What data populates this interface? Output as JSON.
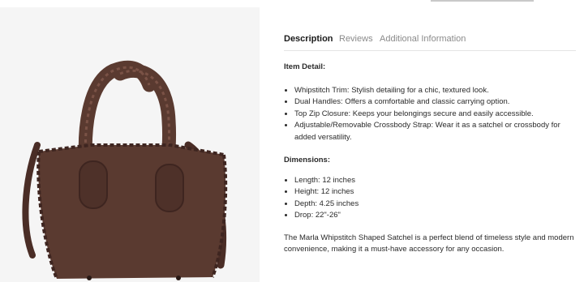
{
  "tabs": [
    {
      "label": "Description",
      "active": true
    },
    {
      "label": "Reviews",
      "active": false
    },
    {
      "label": "Additional Information",
      "active": false
    }
  ],
  "item_detail": {
    "heading": "Item Detail:",
    "bullets": [
      "Whipstitch Trim: Stylish detailing for a chic, textured look.",
      "Dual Handles: Offers a comfortable and classic carrying option.",
      "Top Zip Closure: Keeps your belongings secure and easily accessible.",
      "Adjustable/Removable Crossbody Strap: Wear it as a satchel or crossbody for added versatility."
    ]
  },
  "dimensions": {
    "heading": "Dimensions:",
    "bullets": [
      "Length: 12 inches",
      "Height: 12 inches",
      "Depth: 4.25 inches",
      "Drop: 22\"-26\""
    ]
  },
  "summary": "The Marla Whipstitch Shaped Satchel is a perfect blend of timeless style and modern convenience, making it a must-have accessory for any occasion.",
  "colors": {
    "bag": "#5a3a30",
    "bag_dark": "#3e2520",
    "panel_bg": "#f5f5f5",
    "active_tab": "#1a1a1a",
    "inactive_tab": "#8a8a8a"
  }
}
